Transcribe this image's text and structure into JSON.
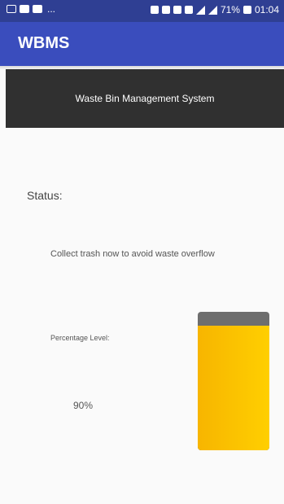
{
  "status_bar": {
    "battery": "71%",
    "time": "01:04"
  },
  "app_bar": {
    "title": "WBMS"
  },
  "header": {
    "title": "Waste Bin Management System"
  },
  "main": {
    "status_label": "Status:",
    "status_message": "Collect trash now to avoid waste overflow",
    "percentage_label": "Percentage Level:",
    "percentage_value": "90%",
    "fill_level": 0.9
  },
  "colors": {
    "status_bar": "#2f3f93",
    "app_bar": "#3a4dbd",
    "header_band": "#303030",
    "bin_fill": "#ffc400",
    "bin_empty": "#6e6e6e"
  }
}
